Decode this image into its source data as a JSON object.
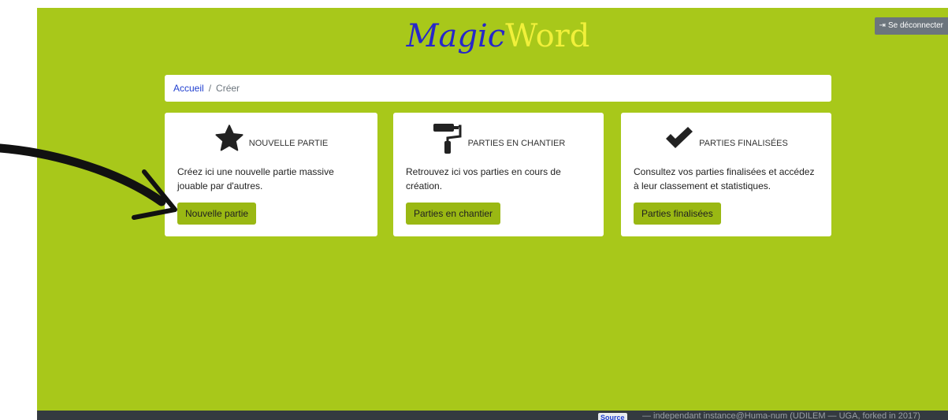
{
  "header": {
    "logo_part1": "Magic",
    "logo_part2": "Word",
    "logout_label": "Se déconnecter"
  },
  "breadcrumb": {
    "home": "Accueil",
    "separator": "/",
    "current": "Créer"
  },
  "cards": [
    {
      "icon": "star-icon",
      "title": "NOUVELLE PARTIE",
      "description": "Créez ici une nouvelle partie massive jouable par d'autres.",
      "button": "Nouvelle partie"
    },
    {
      "icon": "paint-roller-icon",
      "title": "PARTIES EN CHANTIER",
      "description": "Retrouvez ici vos parties en cours de création.",
      "button": "Parties en chantier"
    },
    {
      "icon": "checkmark-icon",
      "title": "PARTIES FINALISÉES",
      "description": "Consultez vos parties finalisées et accédez à leur classement et statistiques.",
      "button": "Parties finalisées"
    }
  ],
  "footer": {
    "source_label": "Source",
    "text": "— independant instance@Huma-num (UDILEM — UGA, forked in 2017)"
  },
  "colors": {
    "background": "#a8c81a",
    "button": "#9ab813",
    "logo_magic": "#2727c9",
    "logo_word": "#f1f03a"
  }
}
